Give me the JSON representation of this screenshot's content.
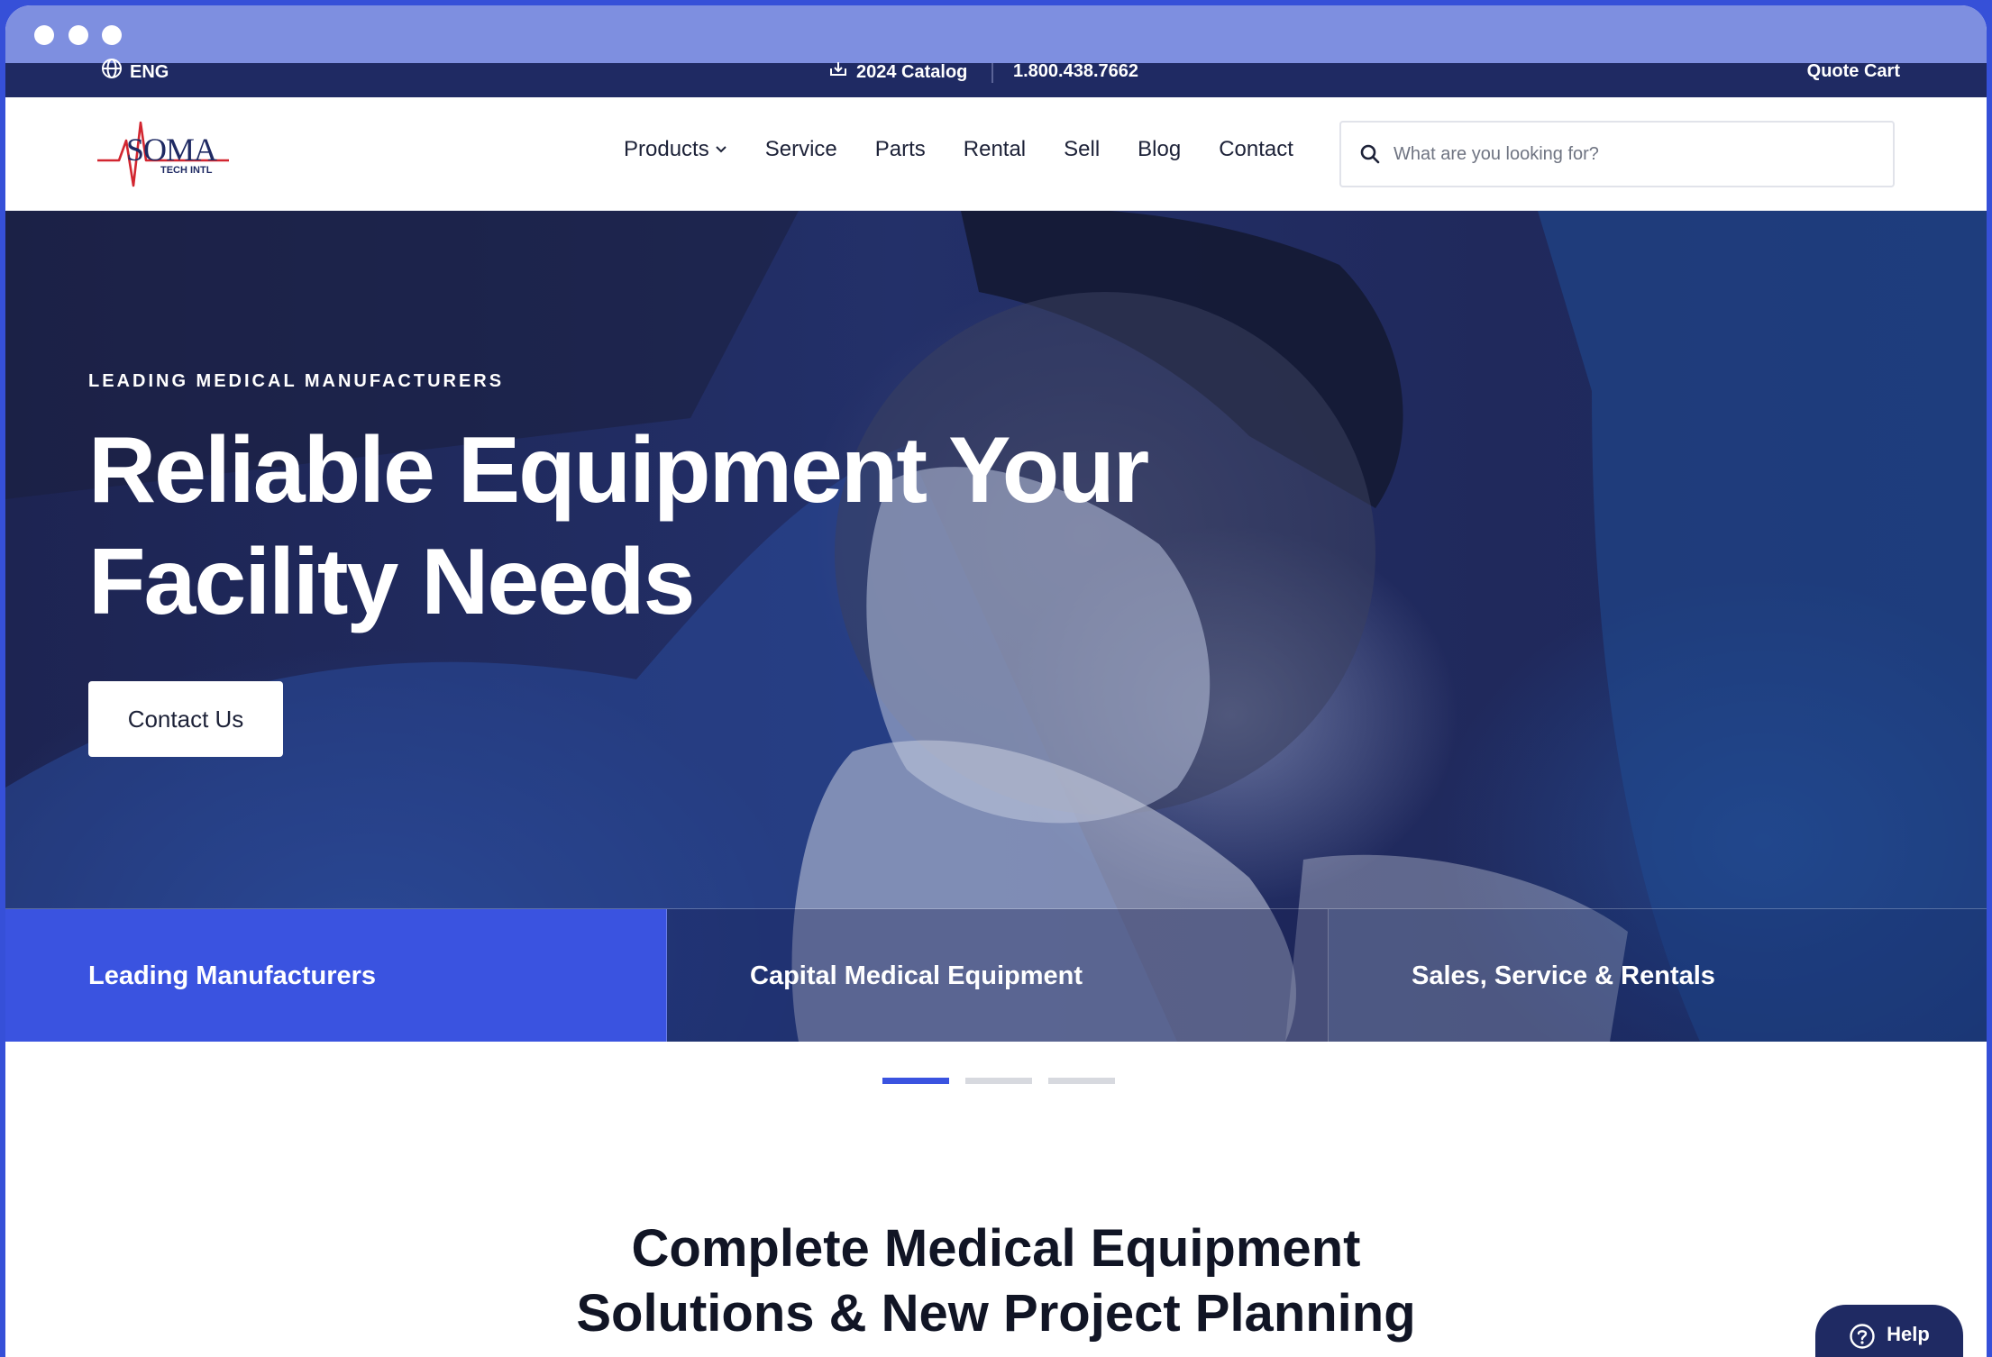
{
  "topbar": {
    "language": "ENG",
    "catalog": "2024 Catalog",
    "phone": "1.800.438.7662",
    "quote_cart": "Quote Cart"
  },
  "logo": {
    "brand": "SOMA",
    "sub": "TECH INTL"
  },
  "nav": {
    "items": [
      {
        "label": "Products",
        "has_dropdown": true
      },
      {
        "label": "Service"
      },
      {
        "label": "Parts"
      },
      {
        "label": "Rental"
      },
      {
        "label": "Sell"
      },
      {
        "label": "Blog"
      },
      {
        "label": "Contact"
      }
    ]
  },
  "search": {
    "placeholder": "What are you looking for?"
  },
  "hero": {
    "eyebrow": "LEADING MEDICAL MANUFACTURERS",
    "headline_line1": "Reliable Equipment Your",
    "headline_line2": "Facility Needs",
    "cta": "Contact Us",
    "tabs": [
      {
        "label": "Leading Manufacturers",
        "active": true
      },
      {
        "label": "Capital Medical Equipment",
        "active": false
      },
      {
        "label": "Sales, Service & Rentals",
        "active": false
      }
    ],
    "slide_count": 3,
    "active_slide": 1
  },
  "section": {
    "title_line1": "Complete Medical Equipment",
    "title_line2": "Solutions & New Project Planning"
  },
  "help": {
    "label": "Help"
  },
  "colors": {
    "primary": "#3a53e0",
    "navy": "#1f2a63",
    "chrome": "#7e8fe0",
    "logo_red": "#d22630",
    "logo_navy": "#1f2a63"
  }
}
